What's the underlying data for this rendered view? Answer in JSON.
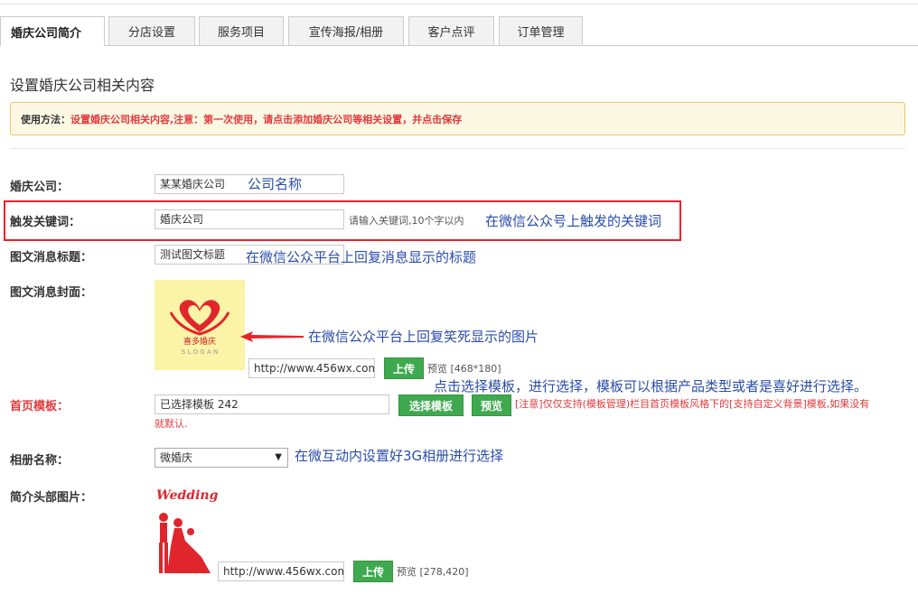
{
  "tabs": [
    {
      "label": "婚庆公司简介",
      "active": true
    },
    {
      "label": "分店设置"
    },
    {
      "label": "服务项目"
    },
    {
      "label": "宣传海报/相册"
    },
    {
      "label": "客户点评"
    },
    {
      "label": "订单管理"
    }
  ],
  "page": {
    "section_title": "设置婚庆公司相关内容",
    "notice_label": "使用方法：",
    "notice_text": "设置婚庆公司相关内容,注意：第一次使用，请点击添加婚庆公司等相关设置，并点击保存"
  },
  "form": {
    "company": {
      "label": "婚庆公司：",
      "value": "某某婚庆公司",
      "note": "公司名称"
    },
    "keyword": {
      "label": "触发关键词：",
      "value": "婚庆公司",
      "hint": "请输入关键词,10个字以内",
      "note": "在微信公众号上触发的关键词"
    },
    "news_title": {
      "label": "图文消息标题：",
      "value": "测试图文标题",
      "note": "在微信公众平台上回复消息显示的标题"
    },
    "cover": {
      "label": "图文消息封面：",
      "logo_text": "喜多婚庆",
      "slogan": "S L O G A N",
      "note": "在微信公众平台上回复笑死显示的图片",
      "url": "http://www.456wx.com,",
      "upload": "上传",
      "preview": "预览",
      "size": "[468*180]"
    },
    "template": {
      "label": "首页模板：",
      "value": "已选择模板 242",
      "select_button": "选择模板",
      "preview_button": "预览",
      "note": "点击选择模板，进行选择，模板可以根据产品类型或者是喜好进行选择。",
      "tip_line1": "[注意]仅仅支持(模板管理)栏目首页模板风格下的[支持自定义背景]模板,如果没有",
      "tip_line2": "就默认."
    },
    "album": {
      "label": "相册名称：",
      "value": "微婚庆",
      "note": "在微互动内设置好3G相册进行选择"
    },
    "header_image": {
      "label": "简介头部图片：",
      "wedding_text": "Wedding",
      "url": "http://www.456wx.com,",
      "upload": "上传",
      "preview": "预览",
      "size": "[278,420]"
    }
  },
  "colors": {
    "accent_red": "#e4393c",
    "annotation_blue": "#2a4dab",
    "button_green": "#3fa94f",
    "notice_bg": "#fcf8e3"
  }
}
